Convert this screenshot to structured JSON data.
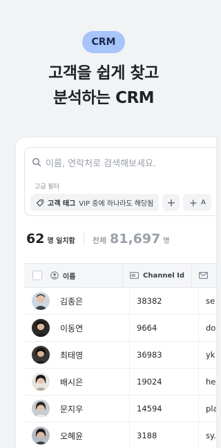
{
  "hero": {
    "badge": "CRM",
    "headline_line1": "고객을 쉽게 찾고",
    "headline_line2": "분석하는 CRM"
  },
  "search": {
    "placeholder": "이름, 연락처로 검색해보세요."
  },
  "filters": {
    "label": "고급 필터",
    "chip_tag": "고객 태그",
    "chip_text": "VIP 중에 하나라도 해당됨",
    "add_chip_label": "A"
  },
  "counts": {
    "matched": "62",
    "matched_unit": "명 일치함",
    "total_label": "전체",
    "total": "81,697",
    "total_unit": "명"
  },
  "table": {
    "headers": {
      "name": "이름",
      "channel": "Channel Id"
    },
    "rows": [
      {
        "name": "김종은",
        "channel": "38382",
        "email": "se"
      },
      {
        "name": "이동연",
        "channel": "9664",
        "email": "do"
      },
      {
        "name": "최태영",
        "channel": "36983",
        "email": "yk"
      },
      {
        "name": "배시은",
        "channel": "19024",
        "email": "he"
      },
      {
        "name": "문지우",
        "channel": "14594",
        "email": "pla"
      },
      {
        "name": "오혜윤",
        "channel": "3188",
        "email": "sy."
      }
    ]
  },
  "colors": {
    "badge_bg": "#a7c4fb",
    "page_bg": "#f1f3f5"
  }
}
